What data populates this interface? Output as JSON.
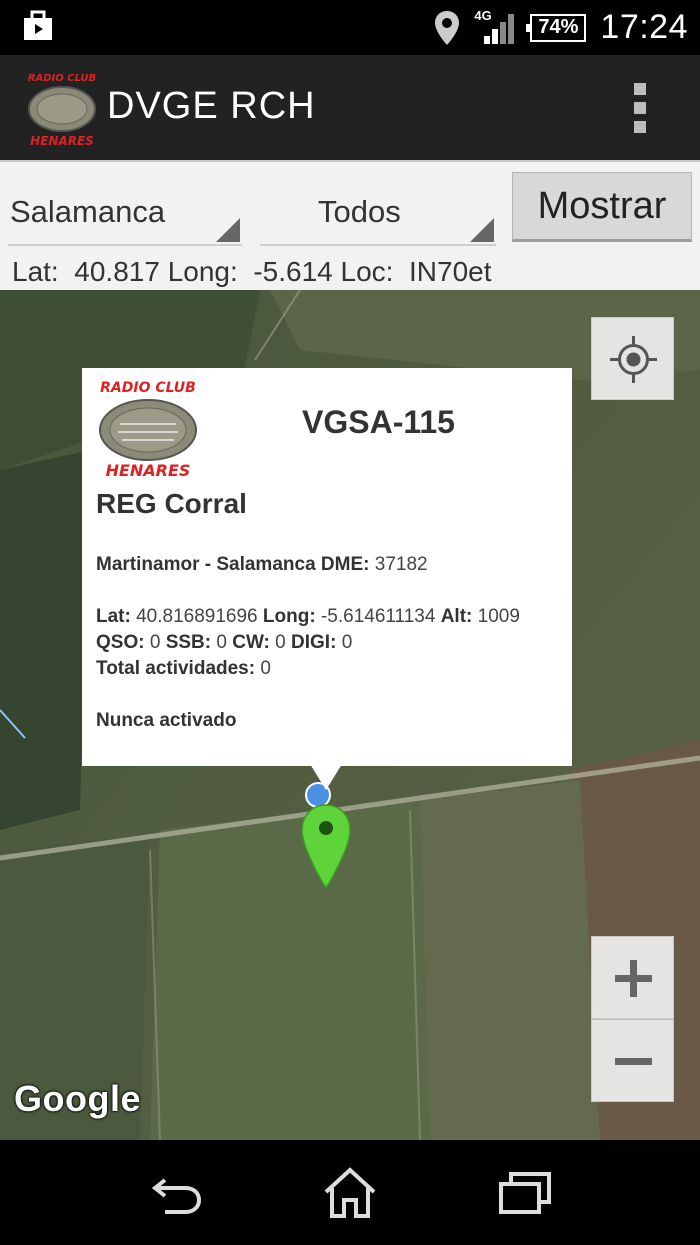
{
  "status_bar": {
    "network_type": "4G",
    "battery": "74%",
    "time": "17:24",
    "icons": [
      "store-bag-icon",
      "location-pin-icon",
      "signal-icon",
      "battery-icon"
    ]
  },
  "action_bar": {
    "title": "DVGE RCH",
    "logo_text_top": "RADIO CLUB",
    "logo_text_bottom": "HENARES",
    "menu_icon": "overflow-menu-icon"
  },
  "controls": {
    "province_selected": "Salamanca",
    "filter_selected": "Todos",
    "show_button_label": "Mostrar",
    "lat_label": "Lat:",
    "lat_value": "40.817",
    "long_label": "Long:",
    "long_value": "-5.614",
    "loc_label": "Loc:",
    "loc_value": "IN70et"
  },
  "map": {
    "attribution": "Google",
    "locate_icon": "my-location-icon",
    "zoom_in_label": "+",
    "zoom_out_label": "−",
    "marker_color": "#5fd33a",
    "user_location_color": "#4a90e2"
  },
  "info_window": {
    "logo_text_top": "RADIO CLUB",
    "logo_text_bottom": "HENARES",
    "code": "VGSA-115",
    "name": "REG Corral",
    "municipality_line": "Martinamor - Salamanca",
    "dme_label": "DME:",
    "dme_value": "37182",
    "lat_label": "Lat:",
    "lat_value": "40.816891696",
    "long_label": "Long:",
    "long_value": "-5.614611134",
    "alt_label": "Alt:",
    "alt_value": "1009",
    "qso_label": "QSO:",
    "qso_value": "0",
    "ssb_label": "SSB:",
    "ssb_value": "0",
    "cw_label": "CW:",
    "cw_value": "0",
    "digi_label": "DIGI:",
    "digi_value": "0",
    "total_label": "Total actividades:",
    "total_value": "0",
    "status": "Nunca activado"
  },
  "nav_bar": {
    "icons": [
      "back-icon",
      "home-icon",
      "recent-apps-icon"
    ]
  }
}
